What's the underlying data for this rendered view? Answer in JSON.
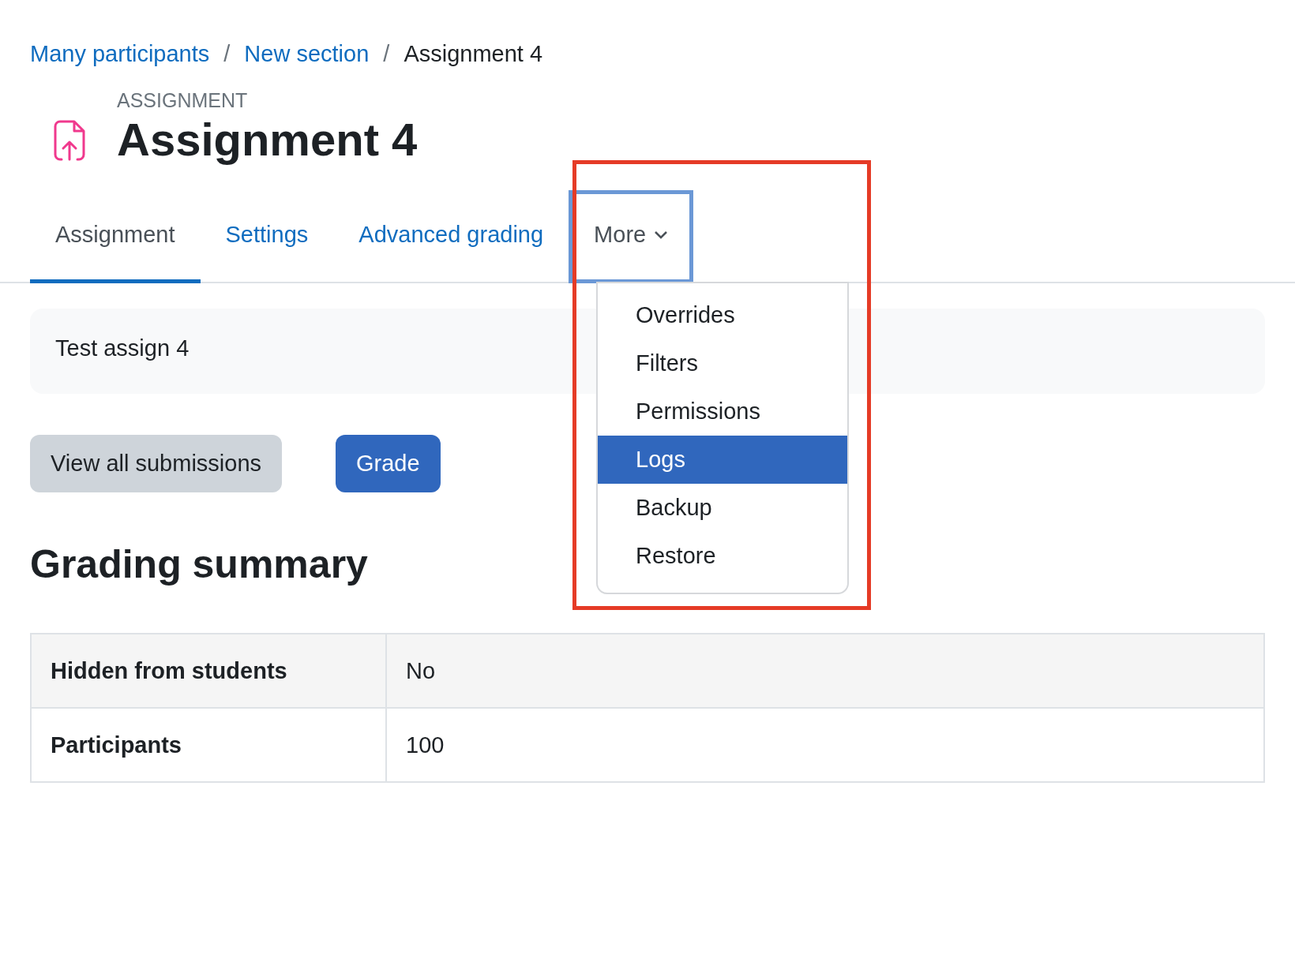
{
  "breadcrumb": [
    {
      "label": "Many participants",
      "kind": "link"
    },
    {
      "label": "New section",
      "kind": "link"
    },
    {
      "label": "Assignment 4",
      "kind": "current"
    }
  ],
  "breadcrumb_separator": "/",
  "header": {
    "overline": "ASSIGNMENT",
    "title": "Assignment 4"
  },
  "tabs": [
    {
      "label": "Assignment",
      "selected": true,
      "kind": "tab"
    },
    {
      "label": "Settings",
      "selected": false,
      "kind": "tab"
    },
    {
      "label": "Advanced grading",
      "selected": false,
      "kind": "tab"
    },
    {
      "label": "More",
      "kind": "menu",
      "expanded": true,
      "focused": true
    }
  ],
  "more_menu": [
    {
      "label": "Overrides",
      "selected": false
    },
    {
      "label": "Filters",
      "selected": false
    },
    {
      "label": "Permissions",
      "selected": false
    },
    {
      "label": "Logs",
      "selected": true
    },
    {
      "label": "Backup",
      "selected": false
    },
    {
      "label": "Restore",
      "selected": false
    }
  ],
  "description": "Test assign 4",
  "actions": [
    {
      "label": "View all submissions",
      "kind": "secondary"
    },
    {
      "label": "Grade",
      "kind": "primary"
    }
  ],
  "summary": {
    "heading": "Grading summary",
    "rows": [
      {
        "label": "Hidden from students",
        "value": "No"
      },
      {
        "label": "Participants",
        "value": "100"
      }
    ]
  }
}
